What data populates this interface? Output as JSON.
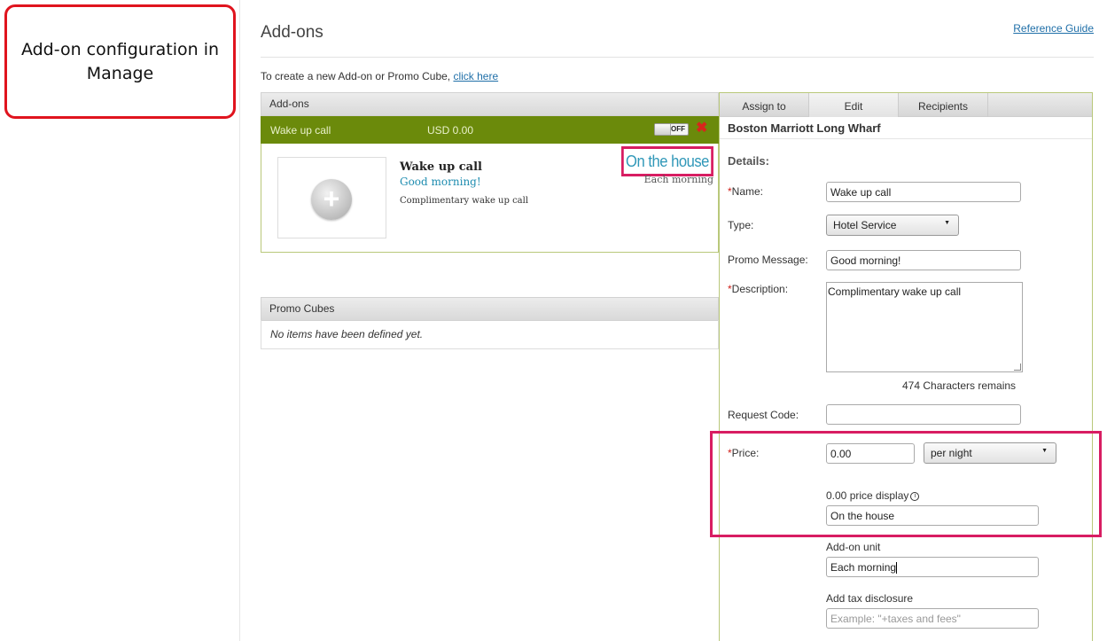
{
  "callout": "Add-on configuration in Manage",
  "page": {
    "title": "Add-ons",
    "reference_guide": "Reference Guide",
    "create_text": "To create a new Add-on or Promo Cube, ",
    "create_link": "click here"
  },
  "addons_panel": {
    "header": "Add-ons",
    "row": {
      "name": "Wake up call",
      "price": "USD 0.00",
      "toggle_label": "OFF"
    },
    "preview": {
      "title": "Wake up call",
      "promo": "Good morning!",
      "description": "Complimentary wake up call",
      "price_display": "On the house",
      "unit": "Each morning"
    }
  },
  "promo_panel": {
    "header": "Promo Cubes",
    "empty": "No items have been defined yet."
  },
  "editor": {
    "tabs": [
      {
        "label": "Assign to"
      },
      {
        "label": "Edit"
      },
      {
        "label": "Recipients"
      }
    ],
    "hotel": "Boston Marriott Long Wharf",
    "details_label": "Details:",
    "name_label": "Name:",
    "name_value": "Wake up call",
    "type_label": "Type:",
    "type_value": "Hotel Service",
    "promo_label": "Promo Message:",
    "promo_value": "Good morning!",
    "desc_label": "Description:",
    "desc_value": "Complimentary wake up call",
    "chars_remaining": "474 Characters remains",
    "request_code_label": "Request Code:",
    "request_code_value": "",
    "price_label": "Price:",
    "price_value": "0.00",
    "price_unit": "per night",
    "zero_price_label": "0.00 price display",
    "zero_price_value": "On the house",
    "addon_unit_label": "Add-on unit",
    "addon_unit_value": "Each morning",
    "tax_label": "Add tax disclosure",
    "tax_placeholder": "Example: \"+taxes and fees\""
  },
  "colors": {
    "green_row": "#6b8a0b",
    "highlight": "#d81d62",
    "link": "#1f6fa8",
    "required": "#d0201a"
  }
}
